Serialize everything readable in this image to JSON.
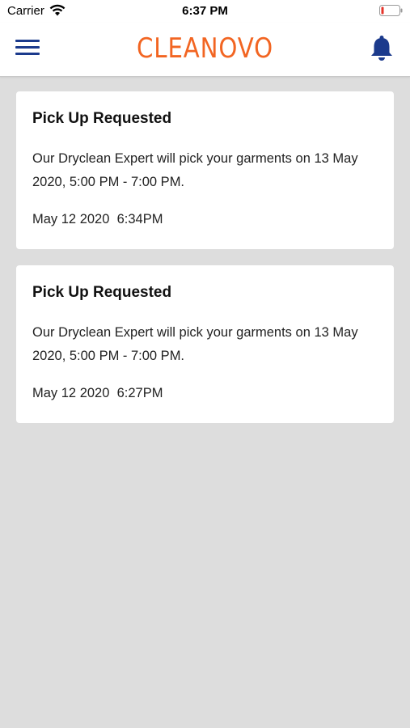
{
  "status_bar": {
    "carrier": "Carrier",
    "time": "6:37 PM"
  },
  "header": {
    "brand": "CLEANOVO",
    "brand_color": "#f26522",
    "icon_color": "#1b3a8c",
    "menu_icon": "hamburger-menu-icon",
    "bell_icon": "bell-icon"
  },
  "notifications": [
    {
      "title": "Pick Up Requested",
      "message": "Our Dryclean Expert will pick your garments on 13 May 2020, 5:00 PM - 7:00 PM.",
      "date": "May 12 2020",
      "time": "6:34PM"
    },
    {
      "title": "Pick Up Requested",
      "message": "Our Dryclean Expert will pick your garments on 13 May 2020, 5:00 PM - 7:00 PM.",
      "date": "May 12 2020",
      "time": "6:27PM"
    }
  ]
}
